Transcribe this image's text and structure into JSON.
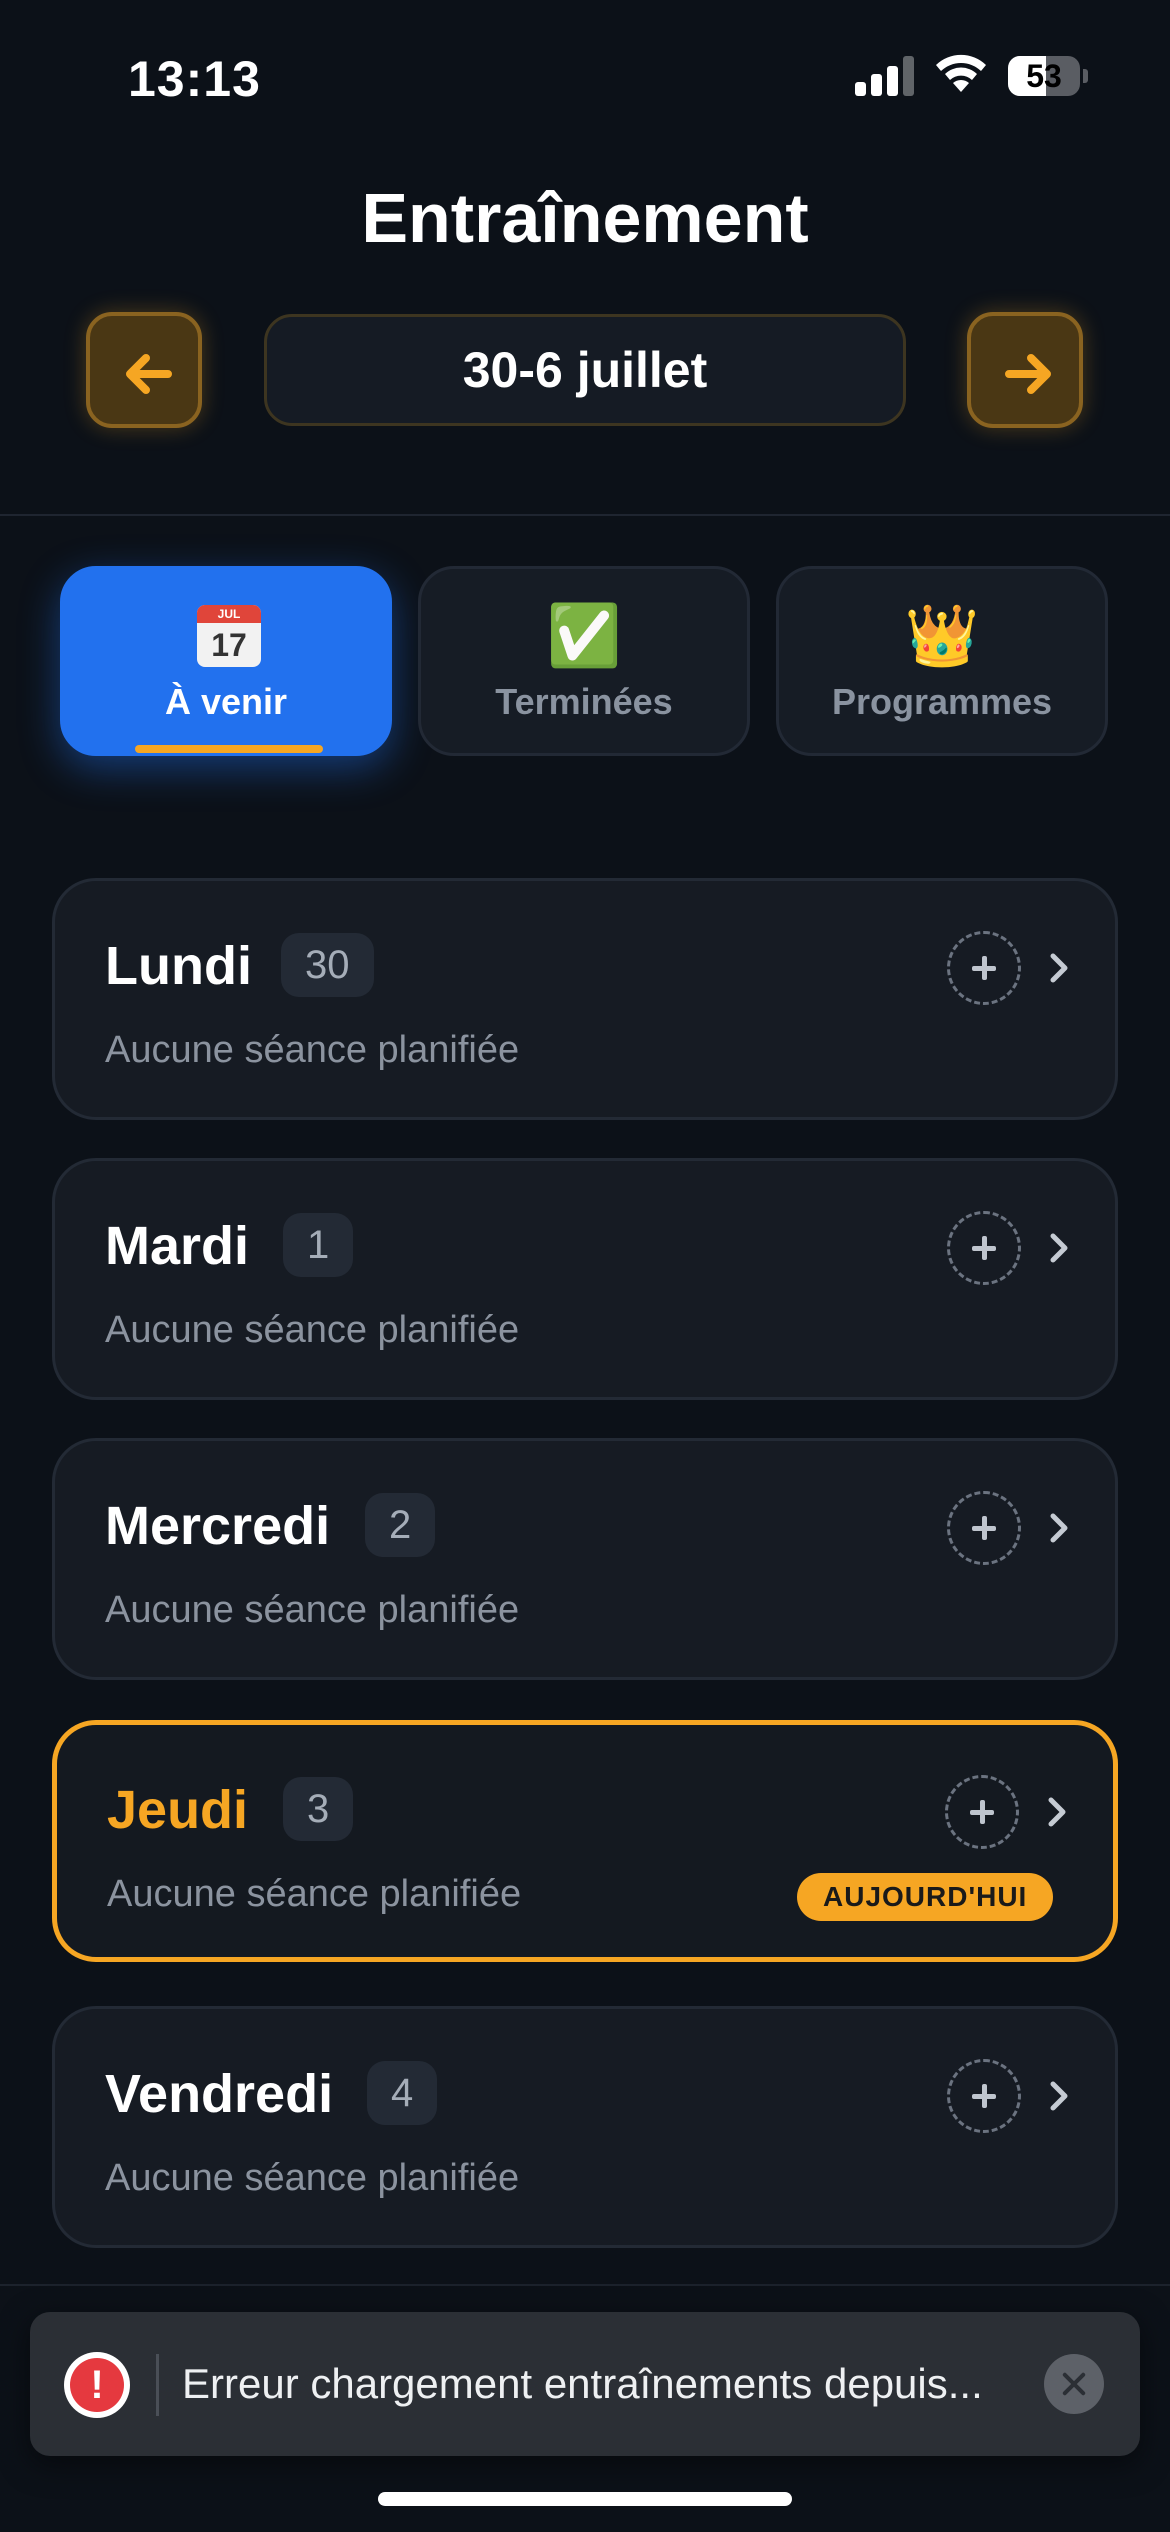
{
  "status_bar": {
    "time": "13:13",
    "battery": "53",
    "battery_level": 0.53
  },
  "header": {
    "title": "Entraînement",
    "week_label": "30-6 juillet"
  },
  "tabs": [
    {
      "label": "À venir",
      "icon": "calendar-icon",
      "calendar_month": "JUL",
      "calendar_day": "17",
      "active": true
    },
    {
      "label": "Terminées",
      "icon": "check-icon",
      "emoji": "✅",
      "active": false
    },
    {
      "label": "Programmes",
      "icon": "crown-icon",
      "emoji": "👑",
      "active": false
    }
  ],
  "days": [
    {
      "name": "Lundi",
      "num": "30",
      "subtitle": "Aucune séance planifiée",
      "today": false
    },
    {
      "name": "Mardi",
      "num": "1",
      "subtitle": "Aucune séance planifiée",
      "today": false
    },
    {
      "name": "Mercredi",
      "num": "2",
      "subtitle": "Aucune séance planifiée",
      "today": false
    },
    {
      "name": "Jeudi",
      "num": "3",
      "subtitle": "Aucune séance planifiée",
      "today": true,
      "badge": "AUJOURD'HUI"
    },
    {
      "name": "Vendredi",
      "num": "4",
      "subtitle": "Aucune séance planifiée",
      "today": false
    }
  ],
  "toast": {
    "message": "Erreur chargement entraînements depuis...",
    "icon": "error-icon"
  },
  "colors": {
    "accent": "#f6a623",
    "primary": "#2271ee",
    "background": "#0c1118",
    "error": "#e5393f"
  }
}
